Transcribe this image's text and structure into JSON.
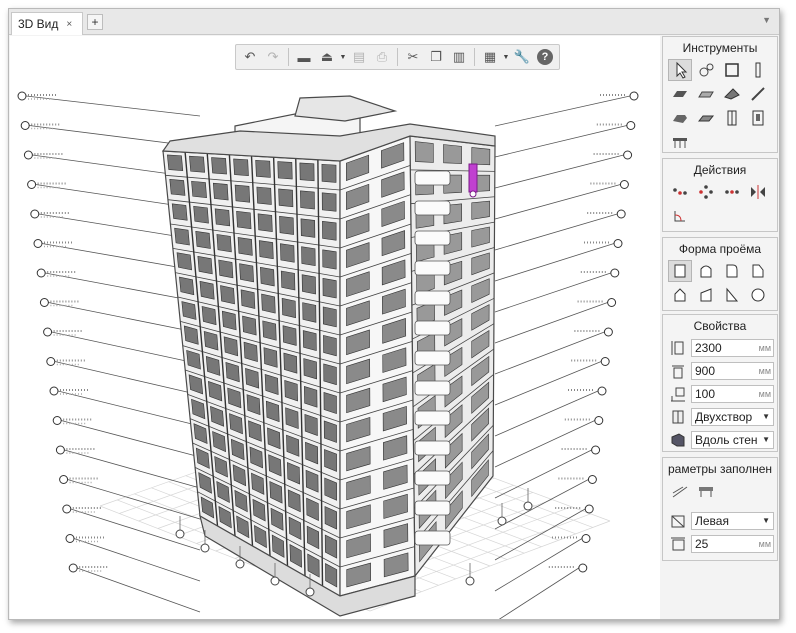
{
  "tab": {
    "label": "3D Вид",
    "close": "×",
    "add": "+",
    "menu": "▼"
  },
  "toolbar": {
    "buttons": [
      {
        "name": "undo-icon",
        "glyph": "↶"
      },
      {
        "name": "redo-icon",
        "glyph": "↷"
      },
      {
        "name": "open-folder-icon",
        "glyph": "▬"
      },
      {
        "name": "save-icon",
        "glyph": "⏏"
      },
      {
        "name": "print-preview-icon",
        "glyph": "▤"
      },
      {
        "name": "print-icon",
        "glyph": "⎙"
      },
      {
        "name": "cut-icon",
        "glyph": "✂"
      },
      {
        "name": "copy-icon",
        "glyph": "❐"
      },
      {
        "name": "paste-icon",
        "glyph": "▥"
      },
      {
        "name": "view-settings-icon",
        "glyph": "▦"
      },
      {
        "name": "wrench-icon",
        "glyph": "🔧"
      },
      {
        "name": "help-icon",
        "glyph": "?"
      }
    ]
  },
  "panels": {
    "tools": {
      "title": "Инструменты",
      "icons": [
        "cursor-icon",
        "dimension-icon",
        "box-icon",
        "column-icon",
        "wall-icon",
        "slab-icon",
        "roof-icon",
        "beam-icon",
        "stair-icon",
        "wall-segment-icon",
        "door-icon",
        "window-icon",
        "railing-icon"
      ]
    },
    "actions": {
      "title": "Действия",
      "icons": [
        "move-icon",
        "rotate-icon",
        "copy-array-icon",
        "mirror-icon",
        "offset-icon"
      ]
    },
    "opening_shape": {
      "title": "Форма проёма",
      "icons": [
        "rect-opening-icon",
        "arch-opening-icon",
        "corner-opening-icon",
        "trapezoid-opening-icon",
        "pentagon-opening-icon",
        "slope-opening-icon",
        "triangle-opening-icon",
        "circle-opening-icon"
      ]
    },
    "properties": {
      "title": "Свойства",
      "height_value": "2300",
      "height_unit": "мм",
      "width_value": "900",
      "width_unit": "мм",
      "sill_value": "100",
      "sill_unit": "мм",
      "type_value": "Двухствор",
      "placement_value": "Вдоль стен",
      "dropdown_arrow": "▼"
    },
    "fill_params": {
      "title": "раметры заполнен",
      "side_value": "Левая",
      "offset_value": "25",
      "offset_unit": "мм",
      "dropdown_arrow": "▼"
    }
  },
  "colors": {
    "selected_object": "#c040d0",
    "building_line": "#4a4a4a"
  }
}
